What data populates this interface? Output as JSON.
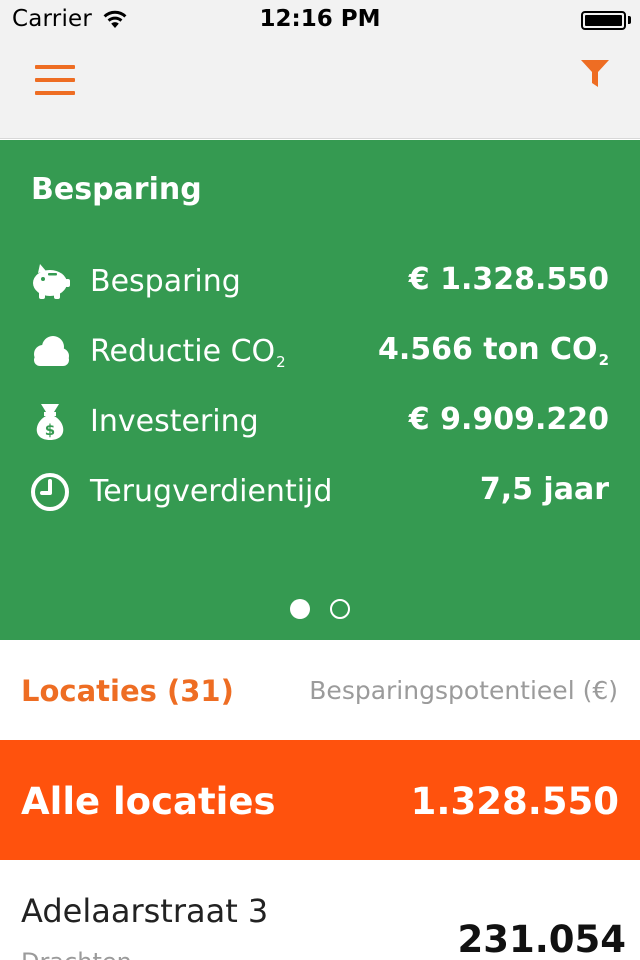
{
  "status_bar": {
    "carrier": "Carrier",
    "time": "12:16 PM"
  },
  "nav": {
    "menu_icon": "hamburger-menu-icon",
    "filter_icon": "filter-funnel-icon"
  },
  "colors": {
    "accent": "#ee6d23",
    "summary_bg": "#359a51",
    "highlight_bg": "#ff520d",
    "muted_text": "#9b9b9b"
  },
  "summary": {
    "title": "Besparing",
    "rows": [
      {
        "icon": "piggy-bank-icon",
        "label": "Besparing",
        "value": "€ 1.328.550"
      },
      {
        "icon": "cloud-icon",
        "label": "Reductie CO",
        "label_sub": "2",
        "value": "4.566 ton CO",
        "value_sub": "2"
      },
      {
        "icon": "money-bag-icon",
        "label": "Investering",
        "value": "€ 9.909.220"
      },
      {
        "icon": "clock-icon",
        "label": "Terugverdientijd",
        "value": "7,5 jaar"
      }
    ],
    "page_indicator": {
      "pages": 2,
      "current": 1
    }
  },
  "list": {
    "header_left": "Locaties (31)",
    "header_right": "Besparingspotentieel (€)",
    "all": {
      "label": "Alle locaties",
      "value": "1.328.550"
    },
    "items": [
      {
        "name": "Adelaarstraat 3",
        "subtitle": "Drachten",
        "value": "231.054"
      }
    ]
  }
}
